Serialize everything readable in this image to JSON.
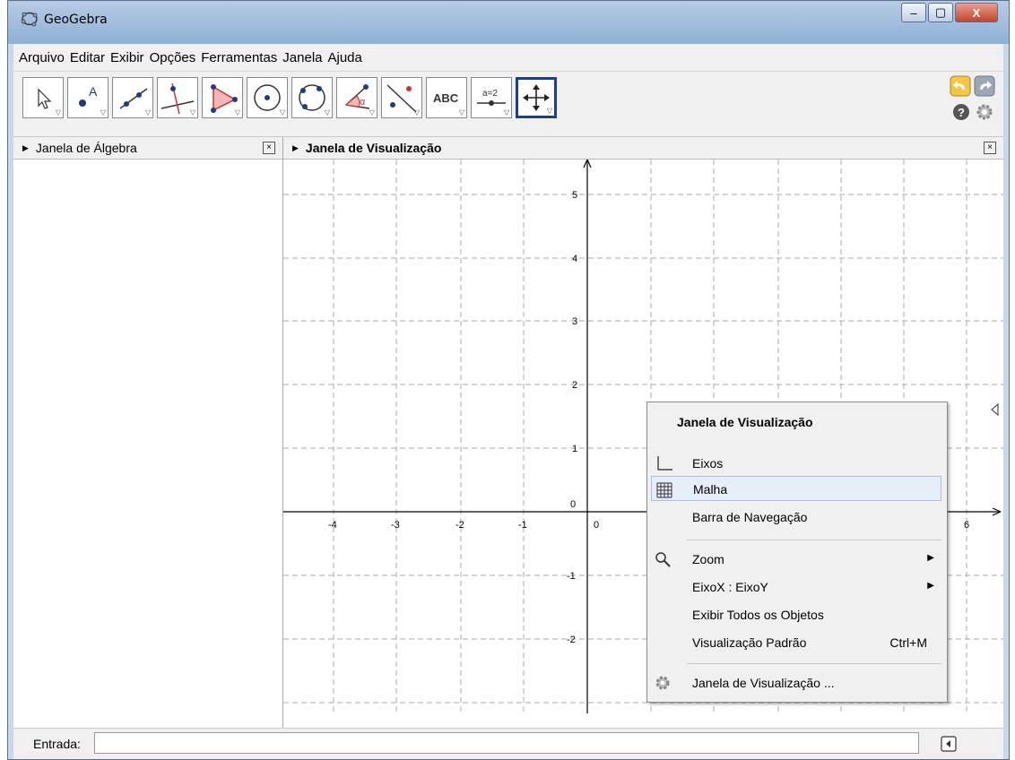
{
  "window": {
    "title": "GeoGebra",
    "minimize": "–",
    "maximize": "▢",
    "close": "X"
  },
  "menu": [
    "Arquivo",
    "Editar",
    "Exibir",
    "Opções",
    "Ferramentas",
    "Janela",
    "Ajuda"
  ],
  "toolbar": {
    "tools": [
      "move-tool",
      "point-tool",
      "line-tool",
      "perpendicular-tool",
      "polygon-tool",
      "circle-tool",
      "conic-tool",
      "angle-tool",
      "reflect-tool",
      "text-tool",
      "slider-tool",
      "move-graphics-tool"
    ],
    "text_label": "ABC",
    "slider_label": "a=2",
    "active_tool": "move-graphics-tool"
  },
  "algebra": {
    "title": "Janela de Álgebra"
  },
  "graphics": {
    "title": "Janela de Visualização",
    "x_ticks": [
      "-4",
      "-3",
      "-2",
      "-1",
      "0",
      "6"
    ],
    "y_ticks": [
      "5",
      "4",
      "3",
      "2",
      "1",
      "0",
      "-1",
      "-2"
    ]
  },
  "context_menu": {
    "header": "Janela de Visualização",
    "items": [
      {
        "label": "Eixos",
        "icon": "axes-icon"
      },
      {
        "label": "Malha",
        "icon": "grid-icon",
        "highlighted": true
      },
      {
        "label": "Barra de Navegação",
        "icon": ""
      },
      {
        "label": "Zoom",
        "icon": "magnifier-icon",
        "submenu": true
      },
      {
        "label": "EixoX : EixoY",
        "icon": "",
        "submenu": true
      },
      {
        "label": "Exibir Todos os Objetos",
        "icon": ""
      },
      {
        "label": "Visualização Padrão",
        "icon": "",
        "shortcut": "Ctrl+M"
      },
      {
        "label": "Janela de Visualização ...",
        "icon": "gear-icon"
      }
    ]
  },
  "input": {
    "label": "Entrada:",
    "value": ""
  }
}
